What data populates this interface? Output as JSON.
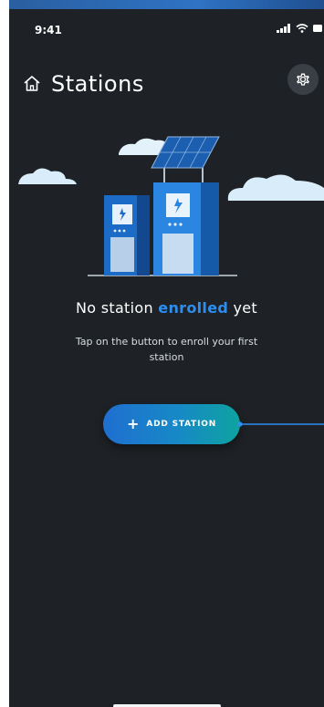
{
  "status_bar": {
    "time": "9:41"
  },
  "header": {
    "home_icon": "home-icon",
    "title": "Stations",
    "settings_icon": "gear-icon"
  },
  "empty_state": {
    "illustration": "charging-stations-illustration",
    "title_before": "No station ",
    "title_highlight": "enrolled",
    "title_after": " yet",
    "description": "Tap on the button to enroll your first station"
  },
  "add_button": {
    "icon": "plus",
    "plus_symbol": "+",
    "label": "ADD STATION"
  },
  "colors": {
    "background": "#1e2226",
    "accent_blue": "#2d8ef0",
    "button_gradient_start": "#1f6fd0",
    "button_gradient_end": "#0ea3a0",
    "settings_button_bg": "#3a3f45"
  }
}
